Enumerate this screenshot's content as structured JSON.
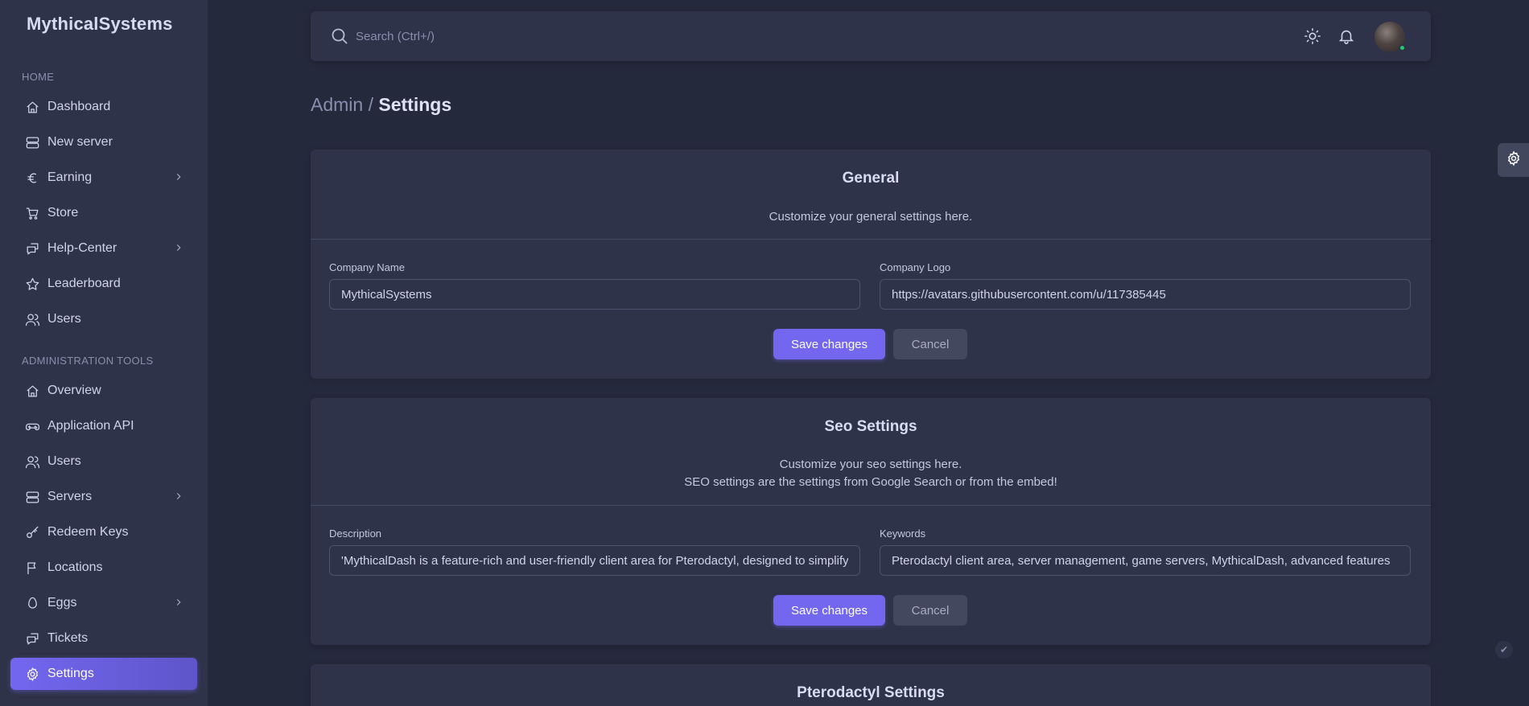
{
  "brand": "MythicalSystems",
  "sidebar": {
    "home_heading": "HOME",
    "admin_heading": "ADMINISTRATION TOOLS",
    "items": [
      {
        "label": "Dashboard"
      },
      {
        "label": "New server"
      },
      {
        "label": "Earning"
      },
      {
        "label": "Store"
      },
      {
        "label": "Help-Center"
      },
      {
        "label": "Leaderboard"
      },
      {
        "label": "Users"
      },
      {
        "label": "Overview"
      },
      {
        "label": "Application API"
      },
      {
        "label": "Users"
      },
      {
        "label": "Servers"
      },
      {
        "label": "Redeem Keys"
      },
      {
        "label": "Locations"
      },
      {
        "label": "Eggs"
      },
      {
        "label": "Tickets"
      },
      {
        "label": "Settings"
      }
    ],
    "active_item": "Settings"
  },
  "topbar": {
    "search_placeholder": "Search (Ctrl+/)"
  },
  "breadcrumb": {
    "parent": "Admin /",
    "current": "Settings"
  },
  "general": {
    "title": "General",
    "subtitle": "Customize your general settings here.",
    "company_name_label": "Company Name",
    "company_name_value": "MythicalSystems",
    "company_logo_label": "Company Logo",
    "company_logo_value": "https://avatars.githubusercontent.com/u/117385445",
    "save_label": "Save changes",
    "cancel_label": "Cancel"
  },
  "seo": {
    "title": "Seo Settings",
    "subtitle_line1": "Customize your seo settings here.",
    "subtitle_line2": "SEO settings are the settings from Google Search or from the embed!",
    "description_label": "Description",
    "description_value": "'MythicalDash is a feature-rich and user-friendly client area for Pterodactyl, designed to simplify server management",
    "keywords_label": "Keywords",
    "keywords_value": "Pterodactyl client area, server management, game servers, MythicalDash, advanced features",
    "save_label": "Save changes",
    "cancel_label": "Cancel"
  },
  "pterodactyl": {
    "title": "Pterodactyl Settings"
  },
  "colors": {
    "accent": "#7367f0",
    "background": "#25293c",
    "surface": "#2f3349"
  }
}
